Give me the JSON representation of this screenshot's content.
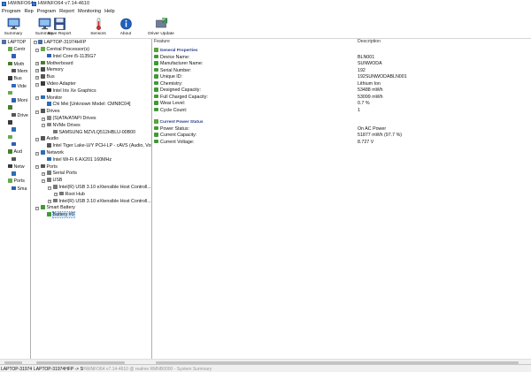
{
  "titlebar": {
    "left_title": "HWiNFO64",
    "right_title": "HWiNFO64 v7.14-4610"
  },
  "menubar": {
    "left": [
      "Program",
      "Rep"
    ],
    "right": [
      "Program",
      "Report",
      "Monitoring",
      "Help"
    ]
  },
  "toolbar": {
    "buttons": [
      {
        "label": "Summary",
        "icon": "monitor-icon"
      },
      {
        "label": "Summary",
        "icon": "monitor-icon"
      },
      {
        "label": "Save Report",
        "icon": "floppy-icon"
      },
      {
        "label": "Sensors",
        "icon": "thermometer-icon"
      },
      {
        "label": "About",
        "icon": "info-icon"
      },
      {
        "label": "Driver Update",
        "icon": "driver-update-icon"
      }
    ]
  },
  "left_tree": {
    "root": "LAPTOP",
    "items": [
      "Centr",
      "",
      "Moth",
      "Mem",
      "Bus",
      "Vide",
      "",
      "Moni",
      "",
      "Drive",
      "",
      "",
      "",
      "",
      "Aud",
      "",
      "Netw",
      "",
      "Ports",
      "Sma"
    ]
  },
  "device_tree": {
    "root": "LAPTOP-31974HFP",
    "items": [
      {
        "label": "Central Processor(s)",
        "level": 1,
        "color": "#6aa84f",
        "expanded": true
      },
      {
        "label": "Intel Core i5-1135G7",
        "level": 2,
        "color": "#2f5fb3"
      },
      {
        "label": "Motherboard",
        "level": 1,
        "color": "#4a7d2a",
        "expanded": false
      },
      {
        "label": "Memory",
        "level": 1,
        "color": "#4a4a4a",
        "expanded": false
      },
      {
        "label": "Bus",
        "level": 1,
        "color": "#555",
        "expanded": false
      },
      {
        "label": "Video Adapter",
        "level": 1,
        "color": "#3a3a3a",
        "expanded": true
      },
      {
        "label": "Intel Iris Xe Graphics",
        "level": 2,
        "color": "#333"
      },
      {
        "label": "Monitor",
        "level": 1,
        "color": "#2d6db5",
        "expanded": true
      },
      {
        "label": "Chi Mei [Unknown Model: CMN8C04]",
        "level": 2,
        "color": "#2d6db5"
      },
      {
        "label": "Drives",
        "level": 1,
        "color": "#555",
        "expanded": true
      },
      {
        "label": "(S)ATA/ATAPI Drives",
        "level": 2,
        "color": "#888",
        "expanded": false
      },
      {
        "label": "NVMe Drives",
        "level": 2,
        "color": "#888",
        "expanded": true
      },
      {
        "label": "SAMSUNG MZVLQ512HBLU-00B00",
        "level": 3,
        "color": "#777"
      },
      {
        "label": "Audio",
        "level": 1,
        "color": "#555",
        "expanded": true
      },
      {
        "label": "Intel Tiger Lake-U/Y PCH-LP - cAVS (Audio, Voice...",
        "level": 2,
        "color": "#555"
      },
      {
        "label": "Network",
        "level": 1,
        "color": "#2d6db5",
        "expanded": true
      },
      {
        "label": "Intel Wi-Fi 6 AX201 160MHz",
        "level": 2,
        "color": "#2d6db5"
      },
      {
        "label": "Ports",
        "level": 1,
        "color": "#555",
        "expanded": true
      },
      {
        "label": "Serial Ports",
        "level": 2,
        "color": "#777",
        "expanded": false
      },
      {
        "label": "USB",
        "level": 2,
        "color": "#777",
        "expanded": true
      },
      {
        "label": "Intel(R) USB 3.10 eXtensible Host Controll...",
        "level": 3,
        "color": "#777",
        "expanded": true
      },
      {
        "label": "Root Hub",
        "level": 4,
        "color": "#777",
        "expanded": false
      },
      {
        "label": "Intel(R) USB 3.10 eXtensible Host Controll...",
        "level": 3,
        "color": "#777",
        "expanded": false
      },
      {
        "label": "Smart Battery",
        "level": 1,
        "color": "#3f9a34",
        "expanded": true
      },
      {
        "label": "Battery #0",
        "level": 2,
        "color": "#3f9a34",
        "selected": true
      }
    ]
  },
  "details": {
    "col_feature": "Feature",
    "col_description": "Description",
    "sections": [
      {
        "title": "General Properties",
        "rows": [
          {
            "feature": "Device Name:",
            "value": "BLN001"
          },
          {
            "feature": "Manufacturer Name:",
            "value": "SUNWODA"
          },
          {
            "feature": "Serial Number:",
            "value": "192"
          },
          {
            "feature": "Unique ID:",
            "value": "192SUNWODABLN001"
          },
          {
            "feature": "Chemistry:",
            "value": "Lithium Ion"
          },
          {
            "feature": "Designed Capacity:",
            "value": "53488 mWh"
          },
          {
            "feature": "Full Charged Capacity:",
            "value": "53099 mWh"
          },
          {
            "feature": "Wear Level:",
            "value": "0.7 %"
          },
          {
            "feature": "Cycle Count:",
            "value": "1"
          }
        ]
      },
      {
        "title": "Current Power Status",
        "rows": [
          {
            "feature": "Power Status:",
            "value": "On AC Power"
          },
          {
            "feature": "Current Capacity:",
            "value": "51877 mWh (97.7 %)"
          },
          {
            "feature": "Current Voltage:",
            "value": "8.727 V"
          }
        ]
      }
    ]
  },
  "statusbar": {
    "left": "LAPTOP-31974",
    "middle": "LAPTOP-31974HFP -> S",
    "right": "HWiNFO64 v7.14-4610 @ realme RMNB0000 - System Summary"
  }
}
